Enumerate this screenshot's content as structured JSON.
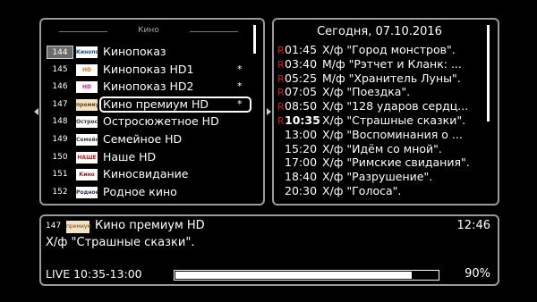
{
  "channel_panel": {
    "group_title": "Кино",
    "channels": [
      {
        "number": "144",
        "logo": "Кинопоказ",
        "logo_bg": "#ffffff",
        "logo_fg": "#1a4c8c",
        "name": "Кинопоказ",
        "favorite": "",
        "selected_number": true,
        "highlighted": false
      },
      {
        "number": "145",
        "logo": "HD",
        "logo_bg": "#ffffff",
        "logo_fg": "#e07020",
        "name": "Кинопоказ HD1",
        "favorite": "*",
        "selected_number": false,
        "highlighted": false
      },
      {
        "number": "146",
        "logo": "HD",
        "logo_bg": "#ffffff",
        "logo_fg": "#d0208a",
        "name": "Кинопоказ HD2",
        "favorite": "*",
        "selected_number": false,
        "highlighted": false
      },
      {
        "number": "147",
        "logo": "премиум",
        "logo_bg": "#f4e3c4",
        "logo_fg": "#6a4b1a",
        "name": "Кино премиум HD",
        "favorite": "*",
        "selected_number": false,
        "highlighted": true
      },
      {
        "number": "148",
        "logo": "Остросюж.",
        "logo_bg": "#ffffff",
        "logo_fg": "#333333",
        "name": "Остросюжетное HD",
        "favorite": "",
        "selected_number": false,
        "highlighted": false
      },
      {
        "number": "149",
        "logo": "Семейное",
        "logo_bg": "#ffffff",
        "logo_fg": "#444444",
        "name": "Семейное HD",
        "favorite": "",
        "selected_number": false,
        "highlighted": false
      },
      {
        "number": "150",
        "logo": "НАШЕ",
        "logo_bg": "#ffffff",
        "logo_fg": "#c81818",
        "name": "Наше HD",
        "favorite": "",
        "selected_number": false,
        "highlighted": false
      },
      {
        "number": "151",
        "logo": "Кино",
        "logo_bg": "#ffffff",
        "logo_fg": "#8a1a1a",
        "name": "Киносвидание",
        "favorite": "",
        "selected_number": false,
        "highlighted": false
      },
      {
        "number": "152",
        "logo": "Родное",
        "logo_bg": "#ffffff",
        "logo_fg": "#2a2a6a",
        "name": "Родное кино",
        "favorite": "",
        "selected_number": false,
        "highlighted": false
      }
    ]
  },
  "epg_panel": {
    "date": "Сегодня, 07.10.2016",
    "programs": [
      {
        "rec": "R",
        "time": "01:45",
        "title": "Х/ф \"Город монстров\"."
      },
      {
        "rec": "R",
        "time": "03:40",
        "title": "М/ф \"Рэтчет и Кланк: ..."
      },
      {
        "rec": "R",
        "time": "05:25",
        "title": "М/ф \"Хранитель Луны\"."
      },
      {
        "rec": "R",
        "time": "07:05",
        "title": "Х/ф \"Поездка\"."
      },
      {
        "rec": "R",
        "time": "08:50",
        "title": "Х/ф \"128 ударов сердц..."
      },
      {
        "rec": "R",
        "time": "10:35",
        "title": "Х/ф \"Страшные сказки\".",
        "current": true
      },
      {
        "rec": "",
        "time": "13:00",
        "title": "Х/ф \"Воспоминания о ..."
      },
      {
        "rec": "",
        "time": "15:20",
        "title": "Х/ф \"Идём со мной\"."
      },
      {
        "rec": "",
        "time": "17:00",
        "title": "Х/ф \"Римские свидания\"."
      },
      {
        "rec": "",
        "time": "18:40",
        "title": "Х/ф \"Разрушение\"."
      },
      {
        "rec": "",
        "time": "20:30",
        "title": "Х/ф \"Голоса\"."
      }
    ]
  },
  "info_panel": {
    "number": "147",
    "logo": "премиум",
    "channel_name": "Кино премиум HD",
    "clock": "12:46",
    "program": "Х/ф \"Страшные сказки\".",
    "live": "LIVE 10:35-13:00",
    "progress": 0.9,
    "percent": "90%"
  },
  "colors": {
    "border": "#9a9a9a",
    "record_marker": "#d21c1c",
    "selected_number_bg": "#6b6b6b"
  },
  "icons": [
    "scroll-left-arrow-icon",
    "scroll-right-arrow-icon",
    "favorite-star-icon",
    "record-icon"
  ]
}
